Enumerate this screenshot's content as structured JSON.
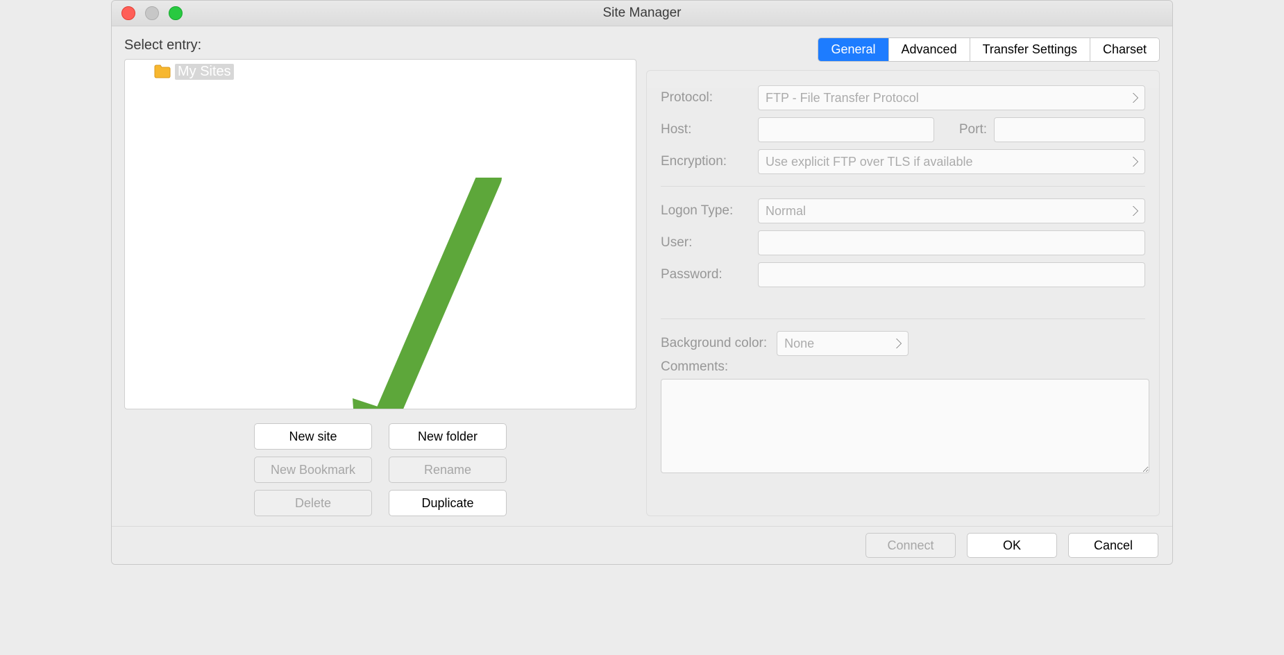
{
  "window": {
    "title": "Site Manager"
  },
  "left": {
    "section_label": "Select entry:",
    "tree": {
      "root_label": "My Sites"
    },
    "buttons": {
      "new_site": "New site",
      "new_folder": "New folder",
      "new_bookmark": "New Bookmark",
      "rename": "Rename",
      "delete": "Delete",
      "duplicate": "Duplicate"
    }
  },
  "tabs": {
    "general": "General",
    "advanced": "Advanced",
    "transfer": "Transfer Settings",
    "charset": "Charset"
  },
  "general": {
    "protocol_label": "Protocol:",
    "protocol_value": "FTP - File Transfer Protocol",
    "host_label": "Host:",
    "host_value": "",
    "port_label": "Port:",
    "port_value": "",
    "encryption_label": "Encryption:",
    "encryption_value": "Use explicit FTP over TLS if available",
    "logon_type_label": "Logon Type:",
    "logon_type_value": "Normal",
    "user_label": "User:",
    "user_value": "",
    "password_label": "Password:",
    "password_value": "",
    "bg_color_label": "Background color:",
    "bg_color_value": "None",
    "comments_label": "Comments:",
    "comments_value": ""
  },
  "footer": {
    "connect": "Connect",
    "ok": "OK",
    "cancel": "Cancel"
  },
  "annotation": {
    "arrow_points_to": "New site"
  }
}
